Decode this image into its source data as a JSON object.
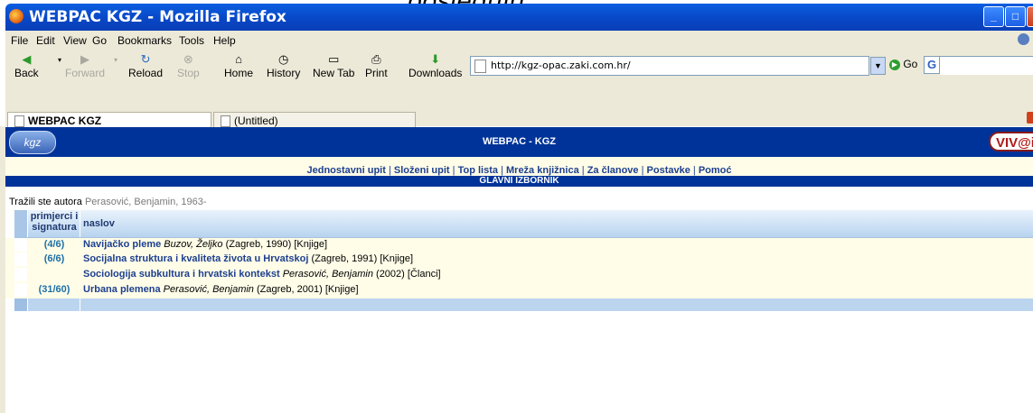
{
  "caption": "posjeduju.",
  "window": {
    "title": "WEBPAC KGZ - Mozilla Firefox"
  },
  "menu": [
    {
      "label": "File"
    },
    {
      "label": "Edit"
    },
    {
      "label": "View"
    },
    {
      "label": "Go"
    },
    {
      "label": "Bookmarks"
    },
    {
      "label": "Tools"
    },
    {
      "label": "Help"
    }
  ],
  "toolbar": {
    "back": "Back",
    "forward": "Forward",
    "reload": "Reload",
    "stop": "Stop",
    "home": "Home",
    "history": "History",
    "newtab": "New Tab",
    "print": "Print",
    "downloads": "Downloads",
    "go": "Go"
  },
  "url": "http://kgz-opac.zaki.com.hr/",
  "tabs": [
    {
      "label": "WEBPAC KGZ",
      "active": true
    },
    {
      "label": "(Untitled)",
      "active": false
    }
  ],
  "banner": {
    "logo": "kgz",
    "title": "WEBPAC - KGZ",
    "viv": "VIV@info"
  },
  "nav": [
    "Jednostavni upit",
    "Složeni upit",
    "Top lista",
    "Mreža knjižnica",
    "Za članove",
    "Postavke",
    "Pomoć"
  ],
  "section_title": "GLAVNI IZBORNIK",
  "search": {
    "prefix": "Tražili ste autora",
    "author": "Perasović, Benjamin, 1963-"
  },
  "table": {
    "col1": "primjerci i signatura",
    "col2": "naslov",
    "rows": [
      {
        "count": "(4/6)",
        "title": "Navijačko pleme",
        "author": "Buzov, Željko",
        "rest": "(Zagreb, 1990) [Knjige]"
      },
      {
        "count": "(6/6)",
        "title": "Socijalna struktura i kvaliteta života u Hrvatskoj",
        "author": "",
        "rest": "(Zagreb, 1991) [Knjige]"
      },
      {
        "count": "",
        "title": "Sociologija subkultura i hrvatski kontekst",
        "author": "Perasović, Benjamin",
        "rest": "(2002) [Članci]"
      },
      {
        "count": "(31/60)",
        "title": "Urbana plemena",
        "author": "Perasović, Benjamin",
        "rest": "(Zagreb, 2001) [Knjige]"
      }
    ]
  },
  "colors": {
    "banner": "#003399",
    "cream": "#fffde8",
    "link": "#1d3f8f",
    "count": "#1d6fa8"
  }
}
